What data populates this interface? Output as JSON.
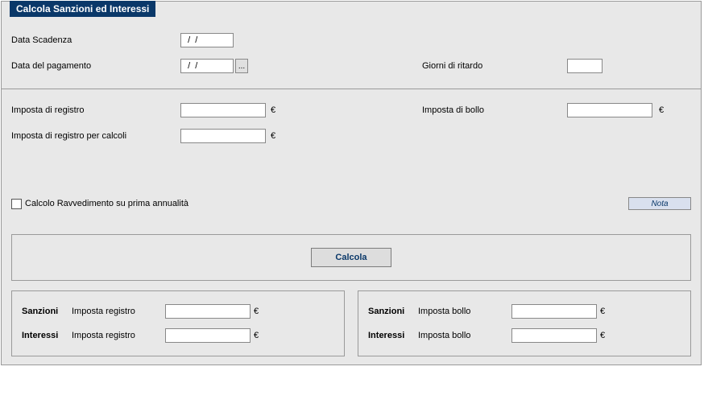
{
  "title": "Calcola Sanzioni ed Interessi",
  "labels": {
    "dataScadenza": "Data Scadenza",
    "dataPagamento": "Data del pagamento",
    "giorniRitardo": "Giorni di ritardo",
    "impostaRegistro": "Imposta di registro",
    "impostaBollo": "Imposta di bollo",
    "impostaRegistroCalcoli": "Imposta di registro per calcoli",
    "calcoloRavvedimento": "Calcolo Ravvedimento su prima annualità",
    "nota": "Nota",
    "calcola": "Calcola",
    "sanzioni": "Sanzioni",
    "interessi": "Interessi",
    "impReg": "Imposta registro",
    "impBol": "Imposta bollo",
    "euro": "€"
  },
  "values": {
    "dataScadenza": "  /  /",
    "dataPagamento": "  /  /",
    "datePickerBtn": "...",
    "giorniRitardo": "",
    "impostaRegistro": "",
    "impostaBollo": "",
    "impostaRegistroCalcoli": "",
    "sanzioniRegistro": "",
    "interessiRegistro": "",
    "sanzioniBollo": "",
    "interessiBollo": "",
    "calcoloRavvedimentoChecked": false
  }
}
